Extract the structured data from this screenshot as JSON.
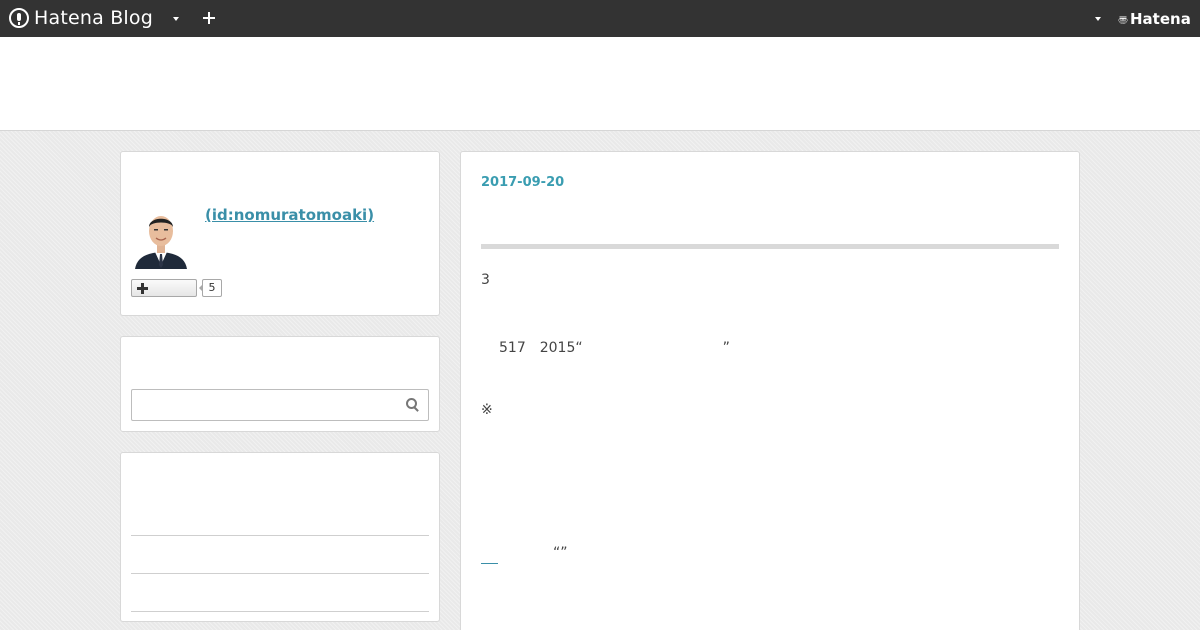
{
  "topbar": {
    "brand": "Hatena Blog",
    "hatena_label": "Hatena",
    "hatena_mark": "〠"
  },
  "profile": {
    "id_text": " (id:nomuratomoaki)",
    "follow_count": "5"
  },
  "search": {
    "value": "",
    "placeholder": ""
  },
  "article": {
    "date": "2017-09-20",
    "para1": "3",
    "para2": "517　2015“　　　　　　　　　　”",
    "para3": "※",
    "para4": "“”"
  },
  "colors": {
    "topbar_bg": "#333333",
    "accent": "#3a9db1",
    "link": "#3a8fa8"
  }
}
